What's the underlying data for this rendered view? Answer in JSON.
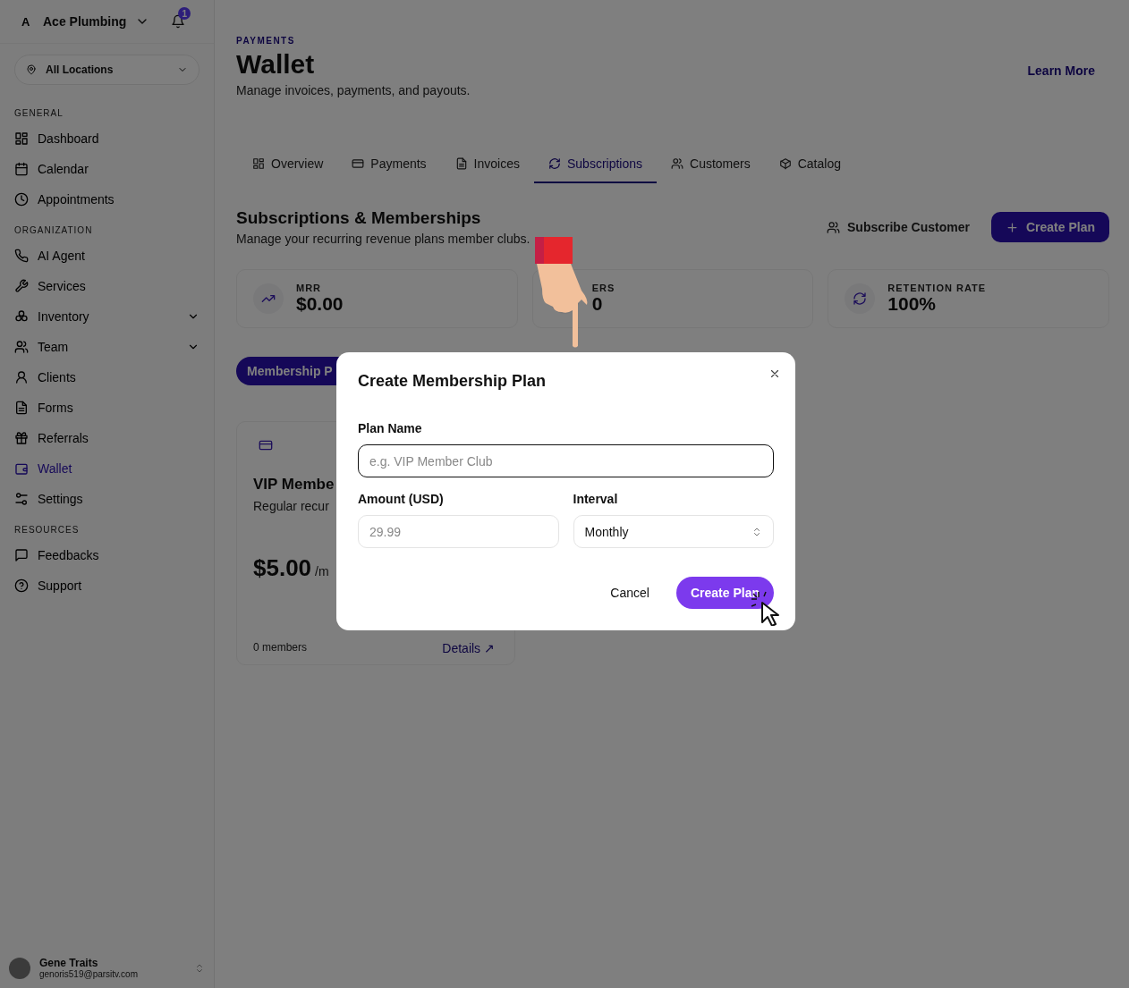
{
  "sidebar": {
    "org": {
      "initial": "A",
      "name": "Ace Plumbing"
    },
    "notifications": "1",
    "location": "All Locations",
    "sections": [
      {
        "heading": "GENERAL",
        "items": [
          {
            "label": "Dashboard",
            "selected": false,
            "has_submenu": false
          },
          {
            "label": "Calendar",
            "selected": false,
            "has_submenu": false
          },
          {
            "label": "Appointments",
            "selected": false,
            "has_submenu": false
          }
        ]
      },
      {
        "heading": "ORGANIZATION",
        "items": [
          {
            "label": "AI Agent",
            "selected": false,
            "has_submenu": false
          },
          {
            "label": "Services",
            "selected": false,
            "has_submenu": false
          },
          {
            "label": "Inventory",
            "selected": false,
            "has_submenu": true
          },
          {
            "label": "Team",
            "selected": false,
            "has_submenu": true
          },
          {
            "label": "Clients",
            "selected": false,
            "has_submenu": false
          },
          {
            "label": "Forms",
            "selected": false,
            "has_submenu": false
          },
          {
            "label": "Referrals",
            "selected": false,
            "has_submenu": false
          },
          {
            "label": "Wallet",
            "selected": true,
            "has_submenu": false
          },
          {
            "label": "Settings",
            "selected": false,
            "has_submenu": false
          }
        ]
      },
      {
        "heading": "RESOURCES",
        "items": [
          {
            "label": "Feedbacks",
            "selected": false,
            "has_submenu": false
          },
          {
            "label": "Support",
            "selected": false,
            "has_submenu": false
          }
        ]
      }
    ],
    "user": {
      "name": "Gene Traits",
      "email": "genoris519@parsitv.com"
    }
  },
  "header": {
    "eyebrow": "PAYMENTS",
    "title": "Wallet",
    "subtitle": "Manage invoices, payments, and payouts.",
    "link": "Learn More"
  },
  "tabs": [
    {
      "label": "Overview",
      "selected": false
    },
    {
      "label": "Payments",
      "selected": false
    },
    {
      "label": "Invoices",
      "selected": false
    },
    {
      "label": "Subscriptions",
      "selected": true
    },
    {
      "label": "Customers",
      "selected": false
    },
    {
      "label": "Catalog",
      "selected": false
    }
  ],
  "section": {
    "title": "Subscriptions & Memberships",
    "subtitle": "Manage your recurring revenue plans member clubs.",
    "secondary_button": "Subscribe Customer",
    "primary_button": "Create Plan"
  },
  "stats": [
    {
      "label": "MRR",
      "value": "$0.00"
    },
    {
      "label": "ERS",
      "value": "0"
    },
    {
      "label": "RETENTION RATE",
      "value": "100%"
    }
  ],
  "filter_pill": "Membership P",
  "plan_card": {
    "title": "VIP Membe",
    "description": "Regular recur",
    "price": "$5.00",
    "period": "/m",
    "members": "0 members",
    "link": "Details ↗"
  },
  "dialog": {
    "title": "Create Membership Plan",
    "fields": [
      {
        "kind": "text",
        "label": "Plan Name",
        "placeholder": "e.g. VIP Member Club",
        "focused": true
      },
      {
        "kind": "text",
        "label": "Amount (USD)",
        "placeholder": "29.99",
        "focused": false
      },
      {
        "kind": "select",
        "label": "Interval",
        "value": "Monthly",
        "focused": false
      }
    ],
    "cancel": "Cancel",
    "submit": "Create Plan"
  }
}
